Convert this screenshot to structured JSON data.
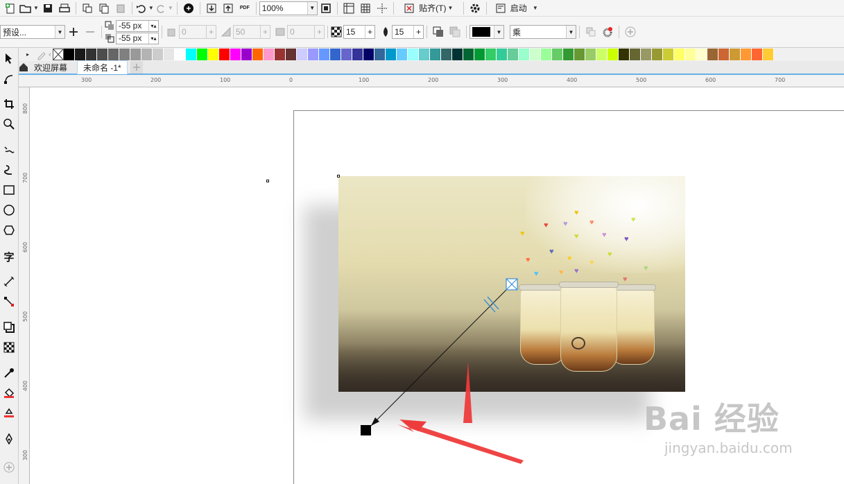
{
  "toolbar1": {
    "zoom": "100%",
    "snap_label": "贴齐(T)",
    "launch_label": "启动",
    "pdf_label": "PDF"
  },
  "toolbar2": {
    "preset": "预设...",
    "offset_x": "-55 px",
    "offset_y": "-55 px",
    "opacity_disabled": "0",
    "feather_disabled": "50",
    "stretch_disabled": "0",
    "transparency": "15",
    "feather": "15",
    "merge_mode": "乘"
  },
  "palette": [
    "#000000",
    "#1a1a1a",
    "#333333",
    "#4d4d4d",
    "#666666",
    "#808080",
    "#999999",
    "#b3b3b3",
    "#cccccc",
    "#e6e6e6",
    "#ffffff",
    "#00ffff",
    "#00ff00",
    "#ffff00",
    "#ff0000",
    "#ff00ff",
    "#9900cc",
    "#ff6600",
    "#ff99cc",
    "#993333",
    "#663333",
    "#ccccff",
    "#9999ff",
    "#6699ff",
    "#3366cc",
    "#6666cc",
    "#333399",
    "#000066",
    "#336699",
    "#0099cc",
    "#66ccff",
    "#99ffff",
    "#66cccc",
    "#339999",
    "#336666",
    "#003333",
    "#006633",
    "#009933",
    "#33cc66",
    "#33cc99",
    "#66cc99",
    "#99ffcc",
    "#ccffcc",
    "#99ff99",
    "#66cc66",
    "#339933",
    "#669933",
    "#99cc66",
    "#ccff66",
    "#ccff00",
    "#333300",
    "#666633",
    "#999966",
    "#999933",
    "#cccc33",
    "#ffff66",
    "#ffff99",
    "#ffffcc",
    "#996633",
    "#cc6633",
    "#cc9933",
    "#ff9933",
    "#ff6633",
    "#ffcc33"
  ],
  "tabs": {
    "welcome": "欢迎屏幕",
    "document": "未命名 -1*"
  },
  "ruler": {
    "top": [
      "300",
      "200",
      "100",
      "0",
      "100",
      "200",
      "300",
      "400",
      "500",
      "600",
      "700"
    ],
    "left": [
      "800",
      "700",
      "600",
      "500",
      "400",
      "300"
    ]
  },
  "watermark": {
    "brand": "Bai 经验",
    "url": "jingyan.baidu.com"
  },
  "colors": {
    "accent": "#66b0e8",
    "arrow": "#ee3b3b",
    "shadow_color": "#000000"
  }
}
